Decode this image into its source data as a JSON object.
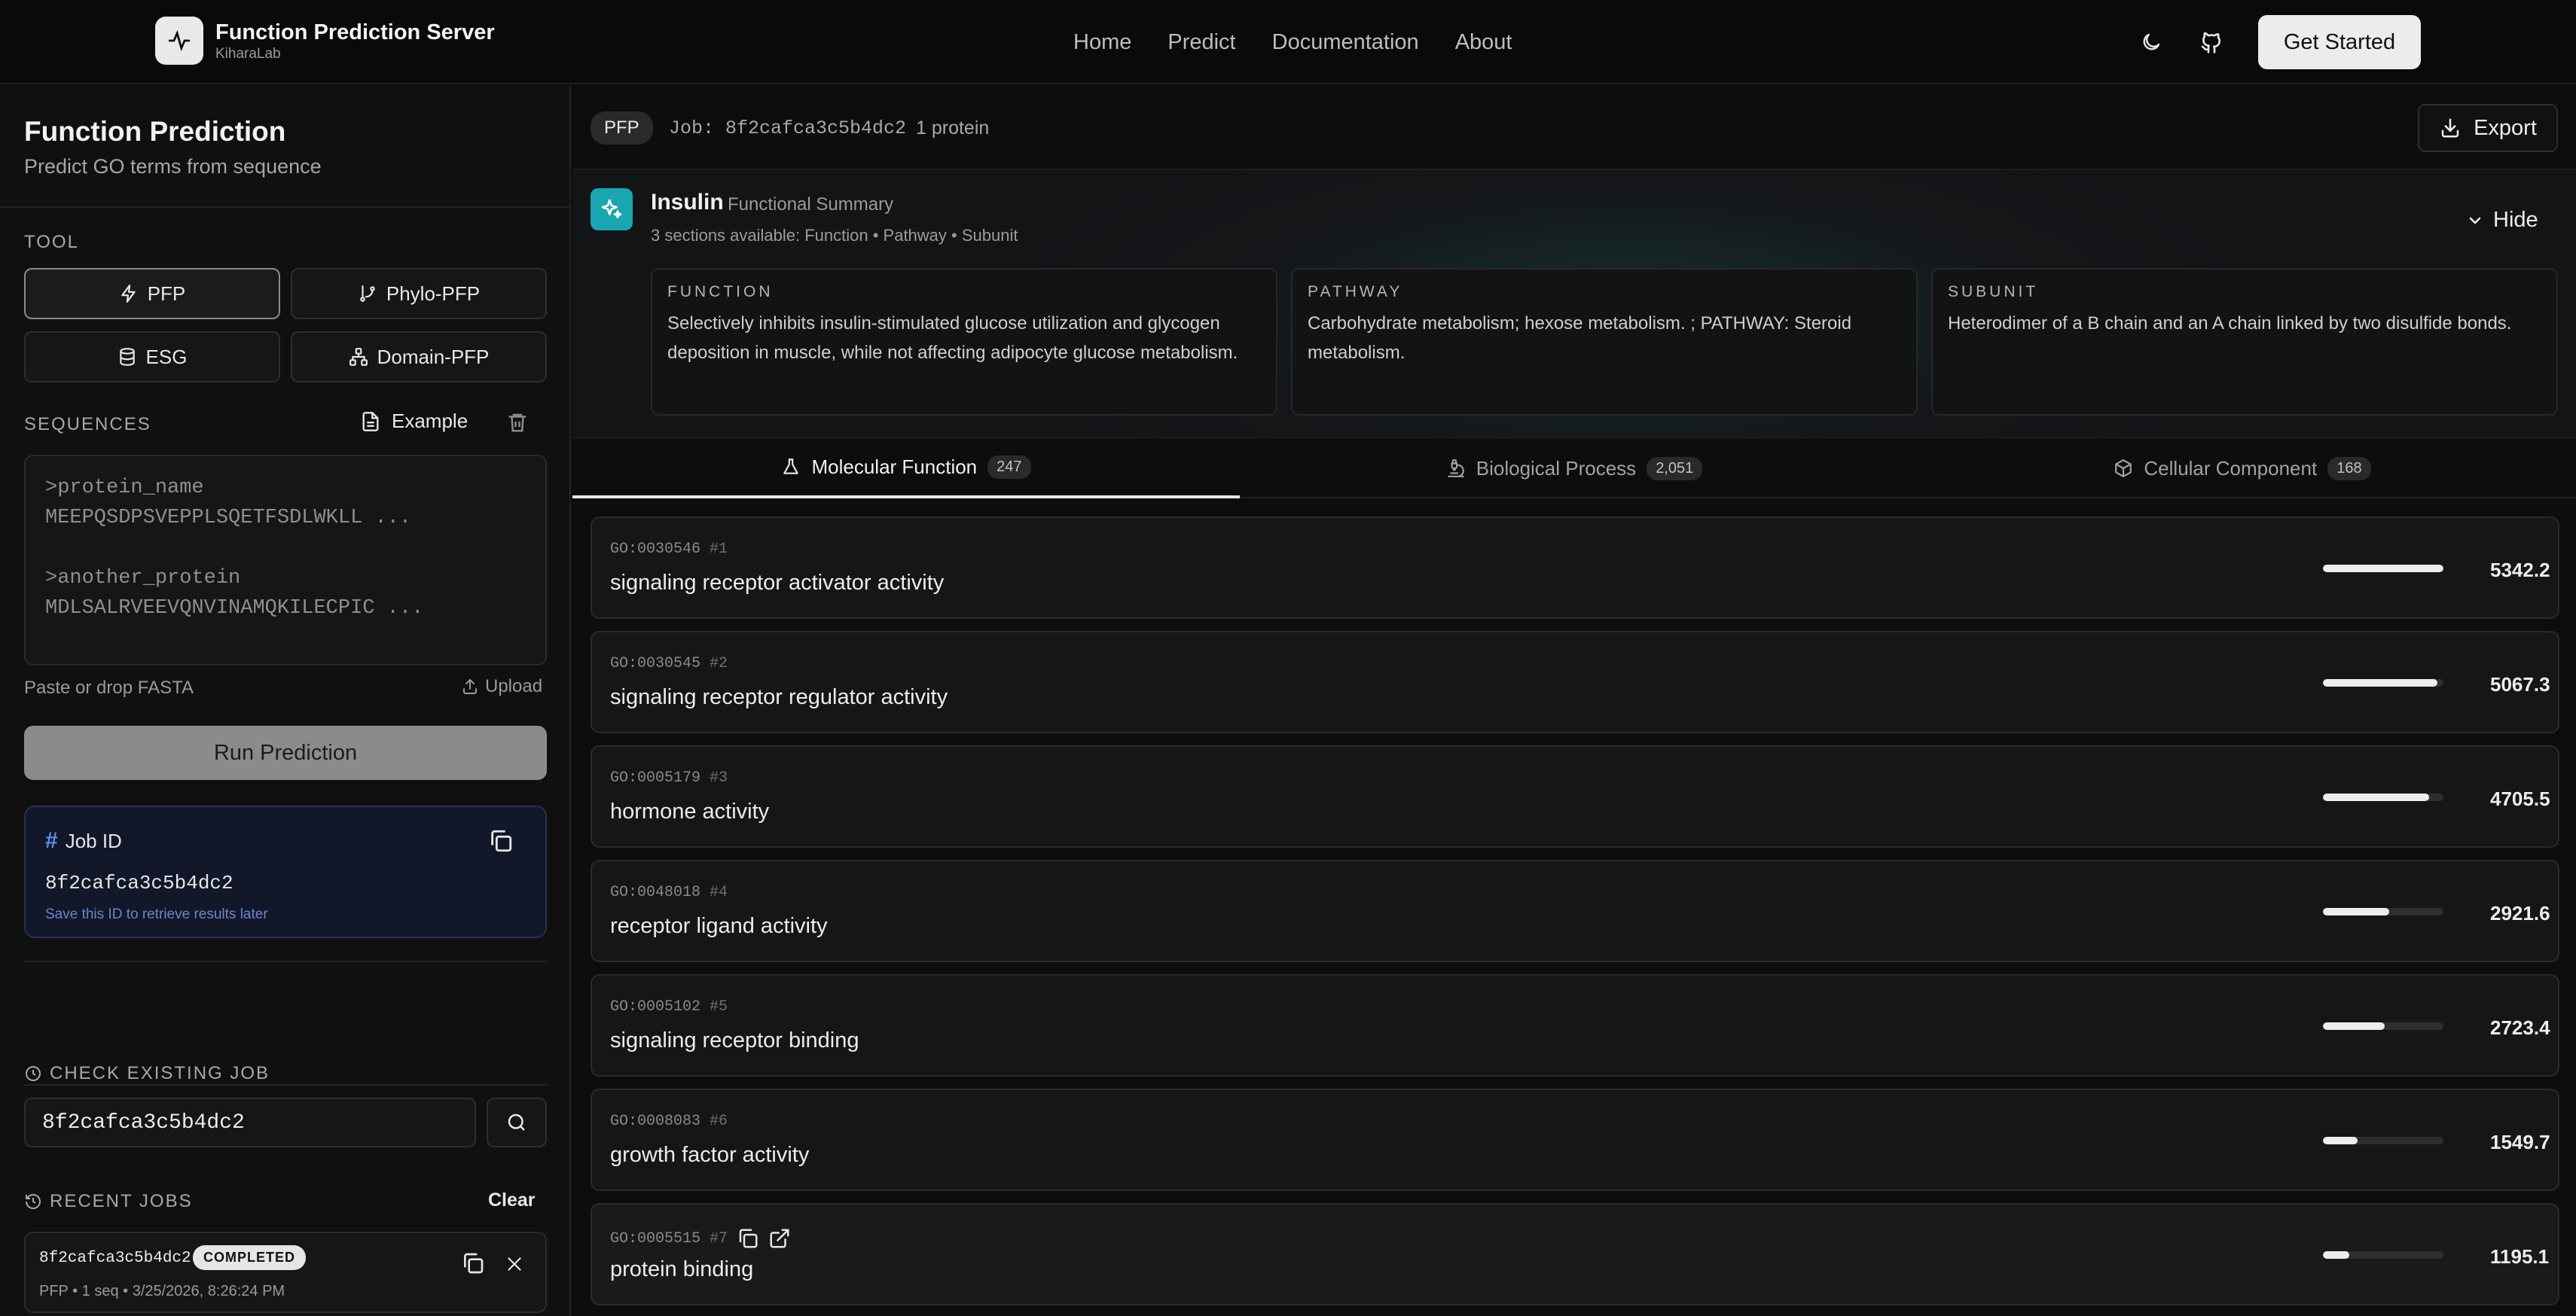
{
  "header": {
    "title": "Function Prediction Server",
    "subtitle": "KiharaLab",
    "nav": [
      "Home",
      "Predict",
      "Documentation",
      "About"
    ],
    "cta": "Get Started"
  },
  "left": {
    "title": "Function Prediction",
    "subtitle": "Predict GO terms from sequence",
    "tool_label": "TOOL",
    "tools": [
      "PFP",
      "Phylo-PFP",
      "ESG",
      "Domain-PFP"
    ],
    "active_tool": "PFP",
    "sequences_label": "SEQUENCES",
    "example_label": "Example",
    "sequence_lines": [
      ">protein_name",
      "MEEPQSDPSVEPPLSQETFSDLWKLL ...",
      ">another_protein",
      "MDLSALRVEEVQNVINAMQKILECPIC ..."
    ],
    "paste_hint": "Paste or drop FASTA",
    "upload_label": "Upload",
    "run_label": "Run Prediction",
    "job_id_label": "Job ID",
    "job_id_value": "8f2cafca3c5b4dc2",
    "job_id_hint": "Save this ID to retrieve results later",
    "check_label": "CHECK EXISTING JOB",
    "check_value": "8f2cafca3c5b4dc2",
    "recent_label": "RECENT JOBS",
    "clear_label": "Clear",
    "recent": {
      "id": "8f2cafca3c5b4dc2",
      "status": "COMPLETED",
      "meta": "PFP • 1 seq • 3/25/2026, 8:26:24 PM"
    }
  },
  "job": {
    "tool_badge": "PFP",
    "label": "Job: 8f2cafca3c5b4dc2",
    "protein_count": "1 protein",
    "export_label": "Export"
  },
  "summary": {
    "protein": "Insulin",
    "kind": "Functional Summary",
    "sections": "3 sections available: Function • Pathway • Subunit",
    "hide_label": "Hide",
    "cards": [
      {
        "label": "FUNCTION",
        "text": "Selectively inhibits insulin-stimulated glucose utilization and glycogen deposition in muscle, while not affecting adipocyte glucose metabolism."
      },
      {
        "label": "PATHWAY",
        "text": "Carbohydrate metabolism; hexose metabolism. ; PATHWAY: Steroid metabolism."
      },
      {
        "label": "SUBUNIT",
        "text": "Heterodimer of a B chain and an A chain linked by two disulfide bonds."
      }
    ]
  },
  "tabs": [
    {
      "label": "Molecular Function",
      "count": "247"
    },
    {
      "label": "Biological Process",
      "count": "2,051"
    },
    {
      "label": "Cellular Component",
      "count": "168"
    }
  ],
  "results": [
    {
      "go": "GO:0030546",
      "rank": "#1",
      "name": "signaling receptor activator activity",
      "score": "5342.2",
      "bar_fraction": 1.0
    },
    {
      "go": "GO:0030545",
      "rank": "#2",
      "name": "signaling receptor regulator activity",
      "score": "5067.3",
      "bar_fraction": 0.95
    },
    {
      "go": "GO:0005179",
      "rank": "#3",
      "name": "hormone activity",
      "score": "4705.5",
      "bar_fraction": 0.88
    },
    {
      "go": "GO:0048018",
      "rank": "#4",
      "name": "receptor ligand activity",
      "score": "2921.6",
      "bar_fraction": 0.55
    },
    {
      "go": "GO:0005102",
      "rank": "#5",
      "name": "signaling receptor binding",
      "score": "2723.4",
      "bar_fraction": 0.51
    },
    {
      "go": "GO:0008083",
      "rank": "#6",
      "name": "growth factor activity",
      "score": "1549.7",
      "bar_fraction": 0.29
    },
    {
      "go": "GO:0005515",
      "rank": "#7",
      "name": "protein binding",
      "score": "1195.1",
      "bar_fraction": 0.22
    }
  ],
  "colors": {
    "accent_teal": "#1aa6b0",
    "job_card_blue": "#121729"
  }
}
